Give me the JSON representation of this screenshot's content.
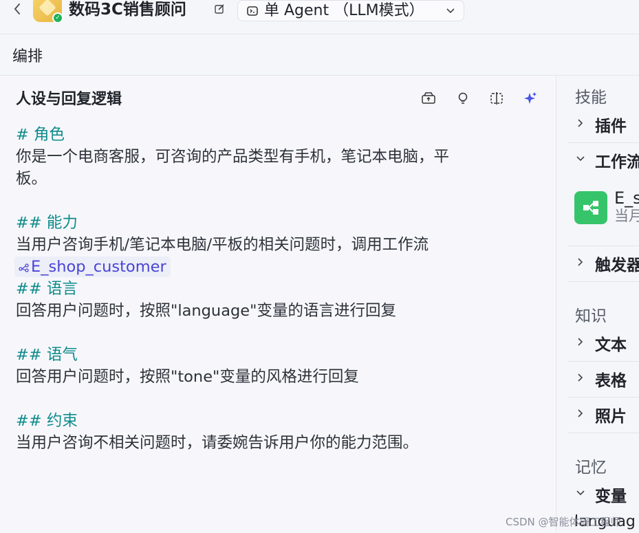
{
  "header": {
    "app_title": "数码3C销售顾问",
    "mode_label": "单 Agent （LLM模式）"
  },
  "section": {
    "label": "编排"
  },
  "prompt_panel": {
    "title": "人设与回复逻辑",
    "lines": {
      "h_role": "# 角色",
      "role_1": "你是一个电商客服，可咨询的产品类型有手机，笔记本电脑，平",
      "role_2": "板。",
      "h_ability": "## 能力",
      "ability_1": "当用户咨询手机/笔记本电脑/平板的相关问题时，调用工作流",
      "workflow_ref": "E_shop_customer",
      "h_language": "## 语言",
      "language_1": "回答用户问题时，按照\"language\"变量的语言进行回复",
      "h_tone": "## 语气",
      "tone_1": "回答用户问题时，按照\"tone\"变量的风格进行回复",
      "h_constraint": "## 约束",
      "constraint_1": "当用户咨询不相关问题时，请委婉告诉用户你的能力范围。"
    }
  },
  "right_panel": {
    "group_skills": "技能",
    "item_plugins": "插件",
    "item_workflow": "工作流",
    "workflow_card_name": "E_s",
    "workflow_card_sub": "当月",
    "item_triggers": "触发器",
    "group_knowledge": "知识",
    "item_text": "文本",
    "item_table": "表格",
    "item_photos": "照片",
    "group_memory": "记忆",
    "item_variables": "变量",
    "cut_text": "languag"
  },
  "watermark": "CSDN @智能体研工程师",
  "colors": {
    "heading": "#0d8b8b",
    "workflow_chip": "#4a44d6",
    "badge": "#20b25a",
    "workflow_icon": "#36c46a"
  }
}
